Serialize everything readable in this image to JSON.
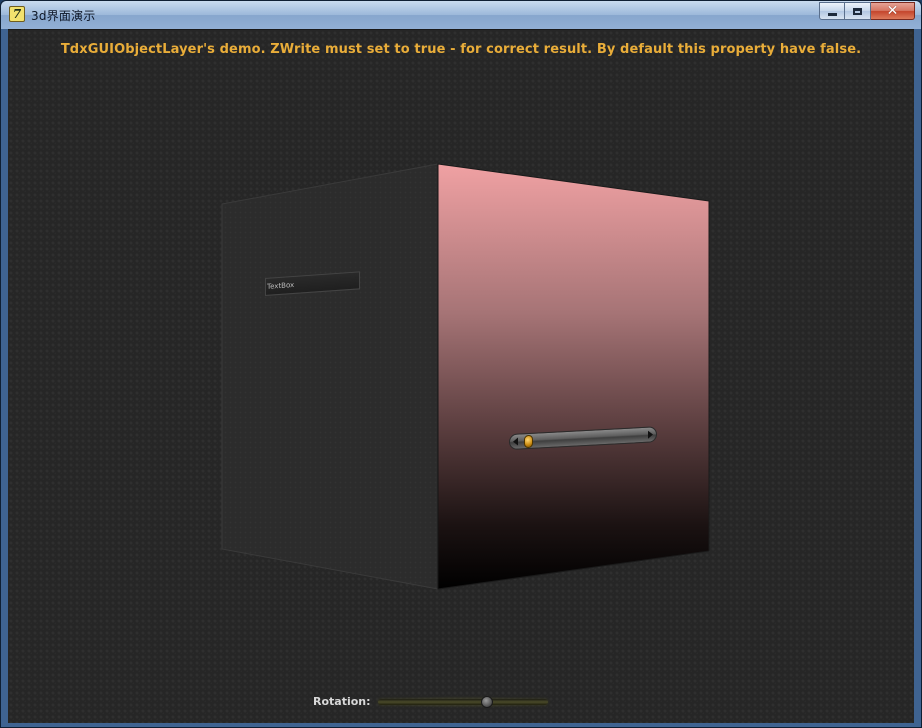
{
  "window": {
    "title": "3d界面演示",
    "app_icon_glyph": "7",
    "buttons": {
      "minimize_icon": "minimize-icon",
      "maximize_icon": "maximize-icon",
      "close_icon": "close-icon",
      "close_glyph": "✕"
    }
  },
  "demo": {
    "headline": "TdxGUIObjectLayer's demo. ZWrite must set to true - for correct result. By default this property have false.",
    "textbox_value": "TextBox",
    "scrollbar_value": 0.04,
    "rotation_label": "Rotation:",
    "rotation_value": 0.65
  },
  "colors": {
    "headline": "#e9ad39",
    "right_face_top": "#f0a1a3",
    "right_face_bottom": "#000000",
    "left_face": "#2c2c2c",
    "background": "#262626"
  }
}
